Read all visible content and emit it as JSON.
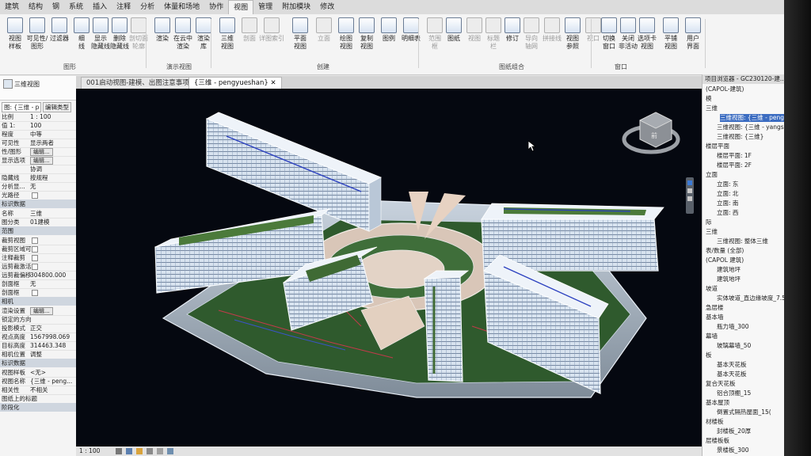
{
  "menu": {
    "items": [
      "建筑",
      "结构",
      "钢",
      "系统",
      "插入",
      "注释",
      "分析",
      "体量和场地",
      "协作",
      "视图",
      "管理",
      "附加模块",
      "修改"
    ],
    "active_index": 9
  },
  "ribbon": {
    "buttons": [
      {
        "label": "视图\n样板",
        "dim": false
      },
      {
        "label": "可见性/\n图形",
        "dim": false
      },
      {
        "label": "过滤器",
        "dim": false
      },
      {
        "label": "细\n线",
        "dim": false
      },
      {
        "label": "显示\n隐藏线",
        "dim": false
      },
      {
        "label": "删除\n隐藏线",
        "dim": false
      },
      {
        "label": "剖切面\n轮廓",
        "dim": true
      },
      {
        "label": "渲染",
        "dim": false
      },
      {
        "label": "在云中\n渲染",
        "dim": false
      },
      {
        "label": "渲染\n库",
        "dim": false
      },
      {
        "label": "三维\n视图",
        "dim": false
      },
      {
        "label": "剖面",
        "dim": true
      },
      {
        "label": "详图索引",
        "dim": true
      },
      {
        "label": "平面\n视图",
        "dim": false
      },
      {
        "label": "立面",
        "dim": true
      },
      {
        "label": "绘图\n视图",
        "dim": false
      },
      {
        "label": "复制\n视图",
        "dim": false
      },
      {
        "label": "图例",
        "dim": false
      },
      {
        "label": "明细表",
        "dim": false
      },
      {
        "label": "范围\n框",
        "dim": true
      },
      {
        "label": "图纸",
        "dim": false
      },
      {
        "label": "视图",
        "dim": true
      },
      {
        "label": "标题\n栏",
        "dim": true
      },
      {
        "label": "修订",
        "dim": false
      },
      {
        "label": "导向\n轴网",
        "dim": true
      },
      {
        "label": "拼接线",
        "dim": true
      },
      {
        "label": "视图\n参照",
        "dim": false
      },
      {
        "label": "视口",
        "dim": true
      },
      {
        "label": "切换\n窗口",
        "dim": false
      },
      {
        "label": "关闭\n非活动",
        "dim": false
      },
      {
        "label": "选项卡\n视图",
        "dim": false
      },
      {
        "label": "平铺\n视图",
        "dim": false
      },
      {
        "label": "用户\n界面",
        "dim": false
      }
    ],
    "panels": [
      "图形",
      "演示视图",
      "创建",
      "图纸组合",
      "窗口"
    ]
  },
  "tabs": [
    {
      "label": "001启动视图-建模、出图注意事项",
      "active": false
    },
    {
      "label": "{三维 - pengyueshan}",
      "active": true
    }
  ],
  "properties": {
    "header_type": "三维视图",
    "selector": "图: {三维 - p",
    "edit_type": "编辑类型",
    "rows": [
      {
        "k": "比例",
        "v": "1 : 100"
      },
      {
        "k": "值 1:",
        "v": "100"
      },
      {
        "k": "程度",
        "v": "中等"
      },
      {
        "k": "可见性",
        "v": "显示两者"
      },
      {
        "k": "性/图形",
        "v": "编辑...",
        "btn": true
      },
      {
        "k": "显示选项",
        "v": "编辑...",
        "btn": true
      },
      {
        "k": "",
        "v": "协调"
      },
      {
        "k": "隐藏线",
        "v": "按规程"
      },
      {
        "k": "分析显...",
        "v": "无"
      },
      {
        "k": "光路径",
        "v": "",
        "cb": true
      }
    ],
    "section_ident": "标识数据",
    "rows2": [
      {
        "k": "名称",
        "v": "三维"
      },
      {
        "k": "图分类",
        "v": "01建模"
      }
    ],
    "section_extent": "范围",
    "rows3": [
      {
        "k": "裁剪视图",
        "v": "",
        "cb": true
      },
      {
        "k": "裁剪区域可见",
        "v": "",
        "cb": true
      },
      {
        "k": "注释裁剪",
        "v": "",
        "cb": true
      },
      {
        "k": "远剪裁激活",
        "v": "",
        "cb": true
      },
      {
        "k": "远剪裁偏移",
        "v": "304800.000"
      },
      {
        "k": "剖面框",
        "v": "无"
      },
      {
        "k": "剖面框",
        "v": "",
        "cb": true
      }
    ],
    "section_camera": "相机",
    "rows4": [
      {
        "k": "渲染设置",
        "v": "编辑...",
        "btn": true
      },
      {
        "k": "锁定的方向",
        "v": ""
      },
      {
        "k": "投影模式",
        "v": "正交"
      },
      {
        "k": "视点高度",
        "v": "1567998.069"
      },
      {
        "k": "目标高度",
        "v": "314463.348"
      },
      {
        "k": "相机位置",
        "v": "调整"
      }
    ],
    "section_ident2": "标识数据",
    "rows5": [
      {
        "k": "视图样板",
        "v": "<无>"
      },
      {
        "k": "视图名称",
        "v": "{三维 - peng..."
      },
      {
        "k": "相关性",
        "v": "不相关"
      },
      {
        "k": "图纸上的标题",
        "v": ""
      }
    ],
    "section_phase": "阶段化"
  },
  "browser": {
    "title": "项目浏览器 - GC230120-建...",
    "items": [
      {
        "t": "(CAPOL-建筑)",
        "sel": false
      },
      {
        "t": "模",
        "sel": false
      },
      {
        "t": "三维",
        "sel": false
      },
      {
        "t": "三维视图: {三维 - pengyues",
        "sel": true
      },
      {
        "t": "三维视图: {三维 - yangshuiji",
        "sel": false
      },
      {
        "t": "三维视图: {三维}",
        "sel": false
      },
      {
        "t": "楼层平面",
        "sel": false
      },
      {
        "t": "楼层平面: 1F",
        "sel": false
      },
      {
        "t": "楼层平面: 2F",
        "sel": false
      },
      {
        "t": "立面",
        "sel": false
      },
      {
        "t": "立面: 东",
        "sel": false
      },
      {
        "t": "立面: 北",
        "sel": false
      },
      {
        "t": "立面: 南",
        "sel": false
      },
      {
        "t": "立面: 西",
        "sel": false
      },
      {
        "t": "际",
        "sel": false
      },
      {
        "t": "三维",
        "sel": false
      },
      {
        "t": "三维视图: 整体三维",
        "sel": false
      },
      {
        "t": "表/数量 (全部)",
        "sel": false
      },
      {
        "t": "(CAPOL 建筑)",
        "sel": false
      },
      {
        "t": "建筑地坪",
        "sel": false
      },
      {
        "t": "建筑地坪",
        "sel": false
      },
      {
        "t": "坡道",
        "sel": false
      },
      {
        "t": "实体坡道_直边缘坡度_7.5%",
        "sel": false
      },
      {
        "t": "急层楼",
        "sel": false
      },
      {
        "t": "基本墙",
        "sel": false
      },
      {
        "t": "瓶力墙_300",
        "sel": false
      },
      {
        "t": "幕墙",
        "sel": false
      },
      {
        "t": "玻璃幕墙_50",
        "sel": false
      },
      {
        "t": "板",
        "sel": false
      },
      {
        "t": "基本天花板",
        "sel": false
      },
      {
        "t": "基本天花板",
        "sel": false
      },
      {
        "t": "复合天花板",
        "sel": false
      },
      {
        "t": "铝合顶棚_15",
        "sel": false
      },
      {
        "t": "基本屋顶",
        "sel": false
      },
      {
        "t": "倒置式隔热屋面_15(",
        "sel": false
      },
      {
        "t": "材楼板",
        "sel": false
      },
      {
        "t": "封楼板_20厚",
        "sel": false
      },
      {
        "t": "层楼板板",
        "sel": false
      },
      {
        "t": "景楼板_300",
        "sel": false
      }
    ]
  },
  "status": {
    "scale": "1 : 100"
  },
  "viewcube": {
    "face_label": "前"
  }
}
